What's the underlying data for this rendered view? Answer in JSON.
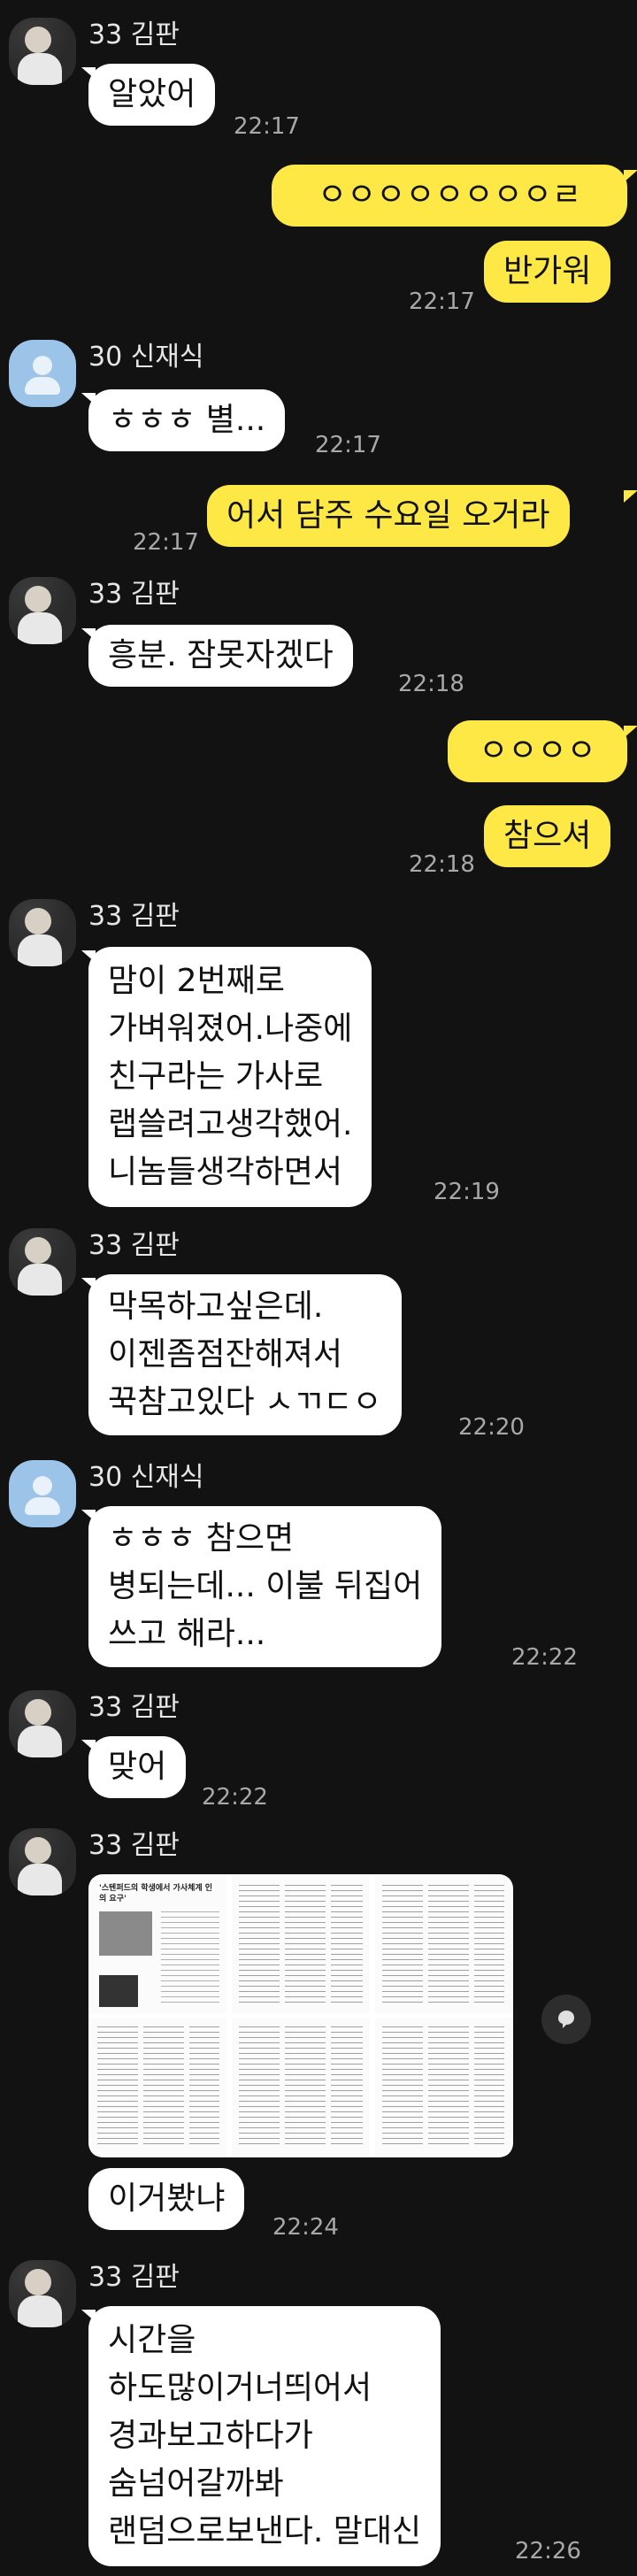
{
  "senders": {
    "kimpan": "33 김판",
    "shin": "30 신재식"
  },
  "messages": [
    {
      "text": "알았어",
      "time": "22:17"
    },
    {
      "text": "ㅇㅇㅇㅇㅇㅇㅇㅇㄹ"
    },
    {
      "text": "반가워",
      "time": "22:17"
    },
    {
      "text": "ㅎㅎㅎ 별...",
      "time": "22:17"
    },
    {
      "text": "어서 담주 수요일 오거라",
      "time": "22:17"
    },
    {
      "text": "흥분. 잠못자겠다",
      "time": "22:18"
    },
    {
      "text": "ㅇㅇㅇㅇ"
    },
    {
      "text": "참으셔",
      "time": "22:18"
    },
    {
      "text": "맘이 2번째로\n가벼워졌어.나중에\n친구라는 가사로\n랩쓸려고생각했어.\n니놈들생각하면서",
      "time": "22:19"
    },
    {
      "text": "막목하고싶은데.\n이젠좀점잔해져서\n꾹참고있다 ㅅㄲㄷㅇ",
      "time": "22:20"
    },
    {
      "text": "ㅎㅎㅎ 참으면\n병되는데... 이불 뒤집어\n쓰고 해라...",
      "time": "22:22"
    },
    {
      "text": "맞어",
      "time": "22:22"
    },
    {
      "text": "이거봤냐",
      "time": "22:24"
    },
    {
      "text": "시간을\n하도많이거너띄어서\n경과보고하다가\n숨넘어갈까봐\n랜덤으로보낸다. 말대신",
      "time": "22:26"
    }
  ],
  "image_preview": {
    "headline": "'스텐퍼드의 학생에서 가사체계 인의 요구'",
    "tiles": 6
  },
  "icons": {
    "share": "share-icon",
    "avatar_default": "person-icon"
  },
  "colors": {
    "background": "#121212",
    "incoming_bubble": "#ffffff",
    "outgoing_bubble": "#fde845",
    "default_avatar": "#9cc3e8"
  }
}
